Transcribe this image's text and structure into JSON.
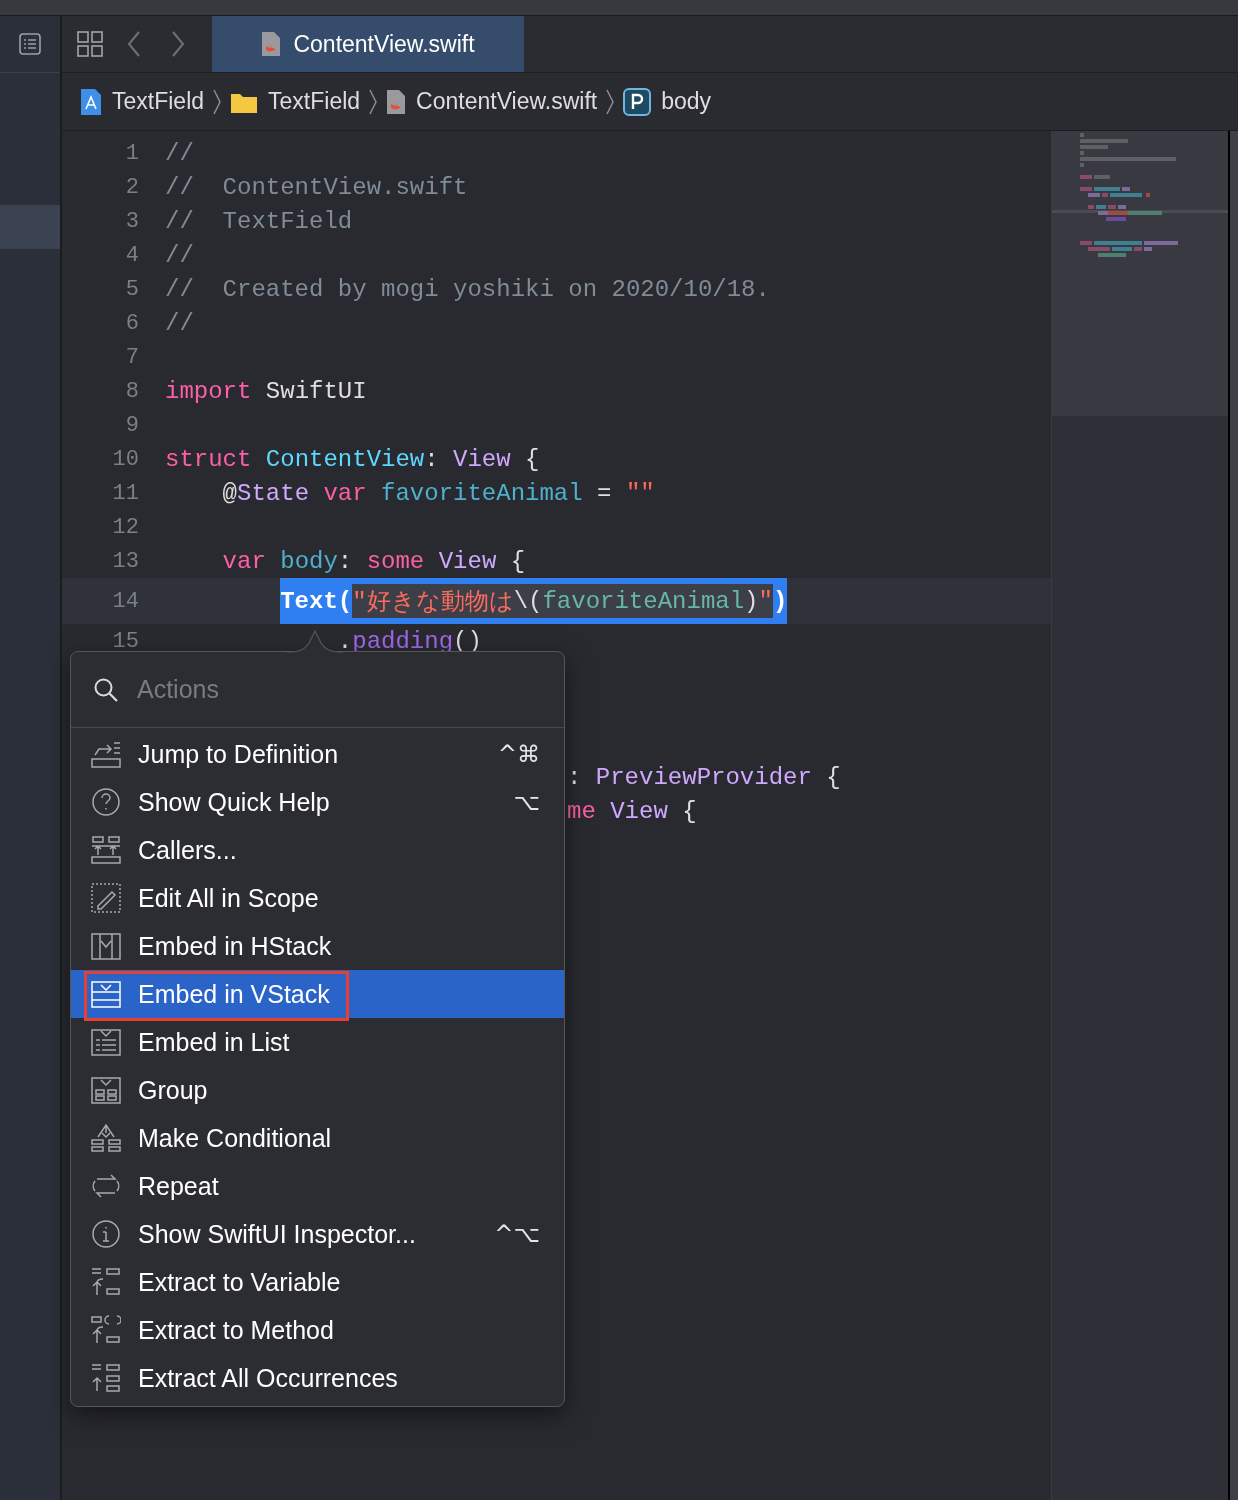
{
  "tab_bar": {
    "tabs": [
      {
        "label": "ContentView.swift",
        "selected": true
      }
    ]
  },
  "breadcrumb": [
    {
      "kind": "project",
      "label": "TextField"
    },
    {
      "kind": "folder",
      "label": "TextField"
    },
    {
      "kind": "file",
      "label": "ContentView.swift"
    },
    {
      "kind": "property",
      "label": "body"
    }
  ],
  "editor": {
    "lines": [
      {
        "number": "1",
        "current": false,
        "tokens": [
          {
            "kind": "comment",
            "text": "//"
          }
        ]
      },
      {
        "number": "2",
        "current": false,
        "tokens": [
          {
            "kind": "comment",
            "text": "//  ContentView.swift"
          }
        ]
      },
      {
        "number": "3",
        "current": false,
        "tokens": [
          {
            "kind": "comment",
            "text": "//  TextField"
          }
        ]
      },
      {
        "number": "4",
        "current": false,
        "tokens": [
          {
            "kind": "comment",
            "text": "//"
          }
        ]
      },
      {
        "number": "5",
        "current": false,
        "tokens": [
          {
            "kind": "comment",
            "text": "//  Created by mogi yoshiki on 2020/10/18."
          }
        ]
      },
      {
        "number": "6",
        "current": false,
        "tokens": [
          {
            "kind": "comment",
            "text": "//"
          }
        ]
      },
      {
        "number": "7",
        "current": false
      },
      {
        "number": "8",
        "current": false,
        "tokens": [
          {
            "kind": "keyword",
            "text": "import"
          },
          {
            "kind": "plain",
            "text": " SwiftUI"
          }
        ]
      },
      {
        "number": "9",
        "current": false
      },
      {
        "number": "10",
        "current": false,
        "tokens": [
          {
            "kind": "keyword",
            "text": "struct"
          },
          {
            "kind": "typedecl",
            "text": " ContentView"
          },
          {
            "kind": "plain",
            "text": ": "
          },
          {
            "kind": "type",
            "text": "View"
          },
          {
            "kind": "plain",
            "text": " {"
          }
        ]
      },
      {
        "number": "11",
        "current": false,
        "tokens": [
          {
            "kind": "plain",
            "text": "    @"
          },
          {
            "kind": "type",
            "text": "State"
          },
          {
            "kind": "keyword",
            "text": " var"
          },
          {
            "kind": "decl",
            "text": " favoriteAnimal"
          },
          {
            "kind": "plain",
            "text": " = "
          },
          {
            "kind": "string",
            "text": "\"\""
          }
        ]
      },
      {
        "number": "12",
        "current": false
      },
      {
        "number": "13",
        "current": false,
        "tokens": [
          {
            "kind": "keyword",
            "text": "    var"
          },
          {
            "kind": "decl",
            "text": " body"
          },
          {
            "kind": "plain",
            "text": ": "
          },
          {
            "kind": "keyword",
            "text": "some"
          },
          {
            "kind": "type",
            "text": " View"
          },
          {
            "kind": "plain",
            "text": " {"
          }
        ]
      },
      {
        "number": "14",
        "current": true,
        "tokens": [
          {
            "kind": "plain",
            "text": "        Text(",
            "selected": true,
            "argument": false
          },
          {
            "kind": "string",
            "text": "\"好きな動物は",
            "selected": true,
            "argument": true
          },
          {
            "kind": "plain",
            "text": "\\(",
            "selected": true,
            "argument": true
          },
          {
            "kind": "ident",
            "text": "favoriteAnimal",
            "selected": true,
            "argument": true
          },
          {
            "kind": "plain",
            "text": ")",
            "selected": true,
            "argument": true
          },
          {
            "kind": "string",
            "text": "\"",
            "selected": true,
            "argument": true
          },
          {
            "kind": "plain",
            "text": ")",
            "selected": true,
            "argument": false
          }
        ]
      },
      {
        "number": "15",
        "current": false,
        "tokens": [
          {
            "kind": "plain",
            "text": "            ."
          },
          {
            "kind": "method",
            "text": "padding"
          },
          {
            "kind": "plain",
            "text": "()"
          }
        ]
      }
    ],
    "covered_lines": [
      {
        "tokens": [
          {
            "kind": "plain",
            "text": ": "
          },
          {
            "kind": "type",
            "text": "PreviewProvider"
          },
          {
            "kind": "plain",
            "text": " {"
          }
        ]
      },
      {
        "tokens": [
          {
            "kind": "keyword",
            "text": "me"
          },
          {
            "kind": "type",
            "text": " View"
          },
          {
            "kind": "plain",
            "text": " {"
          }
        ]
      }
    ]
  },
  "actions_menu": {
    "search": {
      "placeholder": "Actions"
    },
    "items": [
      {
        "kind": "definition",
        "label": "Jump to Definition",
        "shortcut": "^⌘",
        "selected": false,
        "annotated": false
      },
      {
        "kind": "help",
        "label": "Show Quick Help",
        "shortcut": "⌥",
        "selected": false,
        "annotated": false
      },
      {
        "kind": "callers",
        "label": "Callers...",
        "selected": false,
        "annotated": false
      },
      {
        "kind": "edit",
        "label": "Edit All in Scope",
        "selected": false,
        "annotated": false
      },
      {
        "kind": "hstack",
        "label": "Embed in HStack",
        "selected": false,
        "annotated": false
      },
      {
        "kind": "vstack",
        "label": "Embed in VStack",
        "selected": true,
        "annotated": true
      },
      {
        "kind": "list",
        "label": "Embed in List",
        "selected": false,
        "annotated": false
      },
      {
        "kind": "group",
        "label": "Group",
        "selected": false,
        "annotated": false
      },
      {
        "kind": "conditional",
        "label": "Make Conditional",
        "selected": false,
        "annotated": false
      },
      {
        "kind": "repeat",
        "label": "Repeat",
        "selected": false,
        "annotated": false
      },
      {
        "kind": "inspector",
        "label": "Show SwiftUI Inspector...",
        "shortcut": "^⌥",
        "selected": false,
        "annotated": false
      },
      {
        "kind": "variable",
        "label": "Extract to Variable",
        "selected": false,
        "annotated": false
      },
      {
        "kind": "method",
        "label": "Extract to Method",
        "selected": false,
        "annotated": false
      },
      {
        "kind": "occurrences",
        "label": "Extract All Occurrences",
        "selected": false,
        "annotated": false
      }
    ]
  }
}
